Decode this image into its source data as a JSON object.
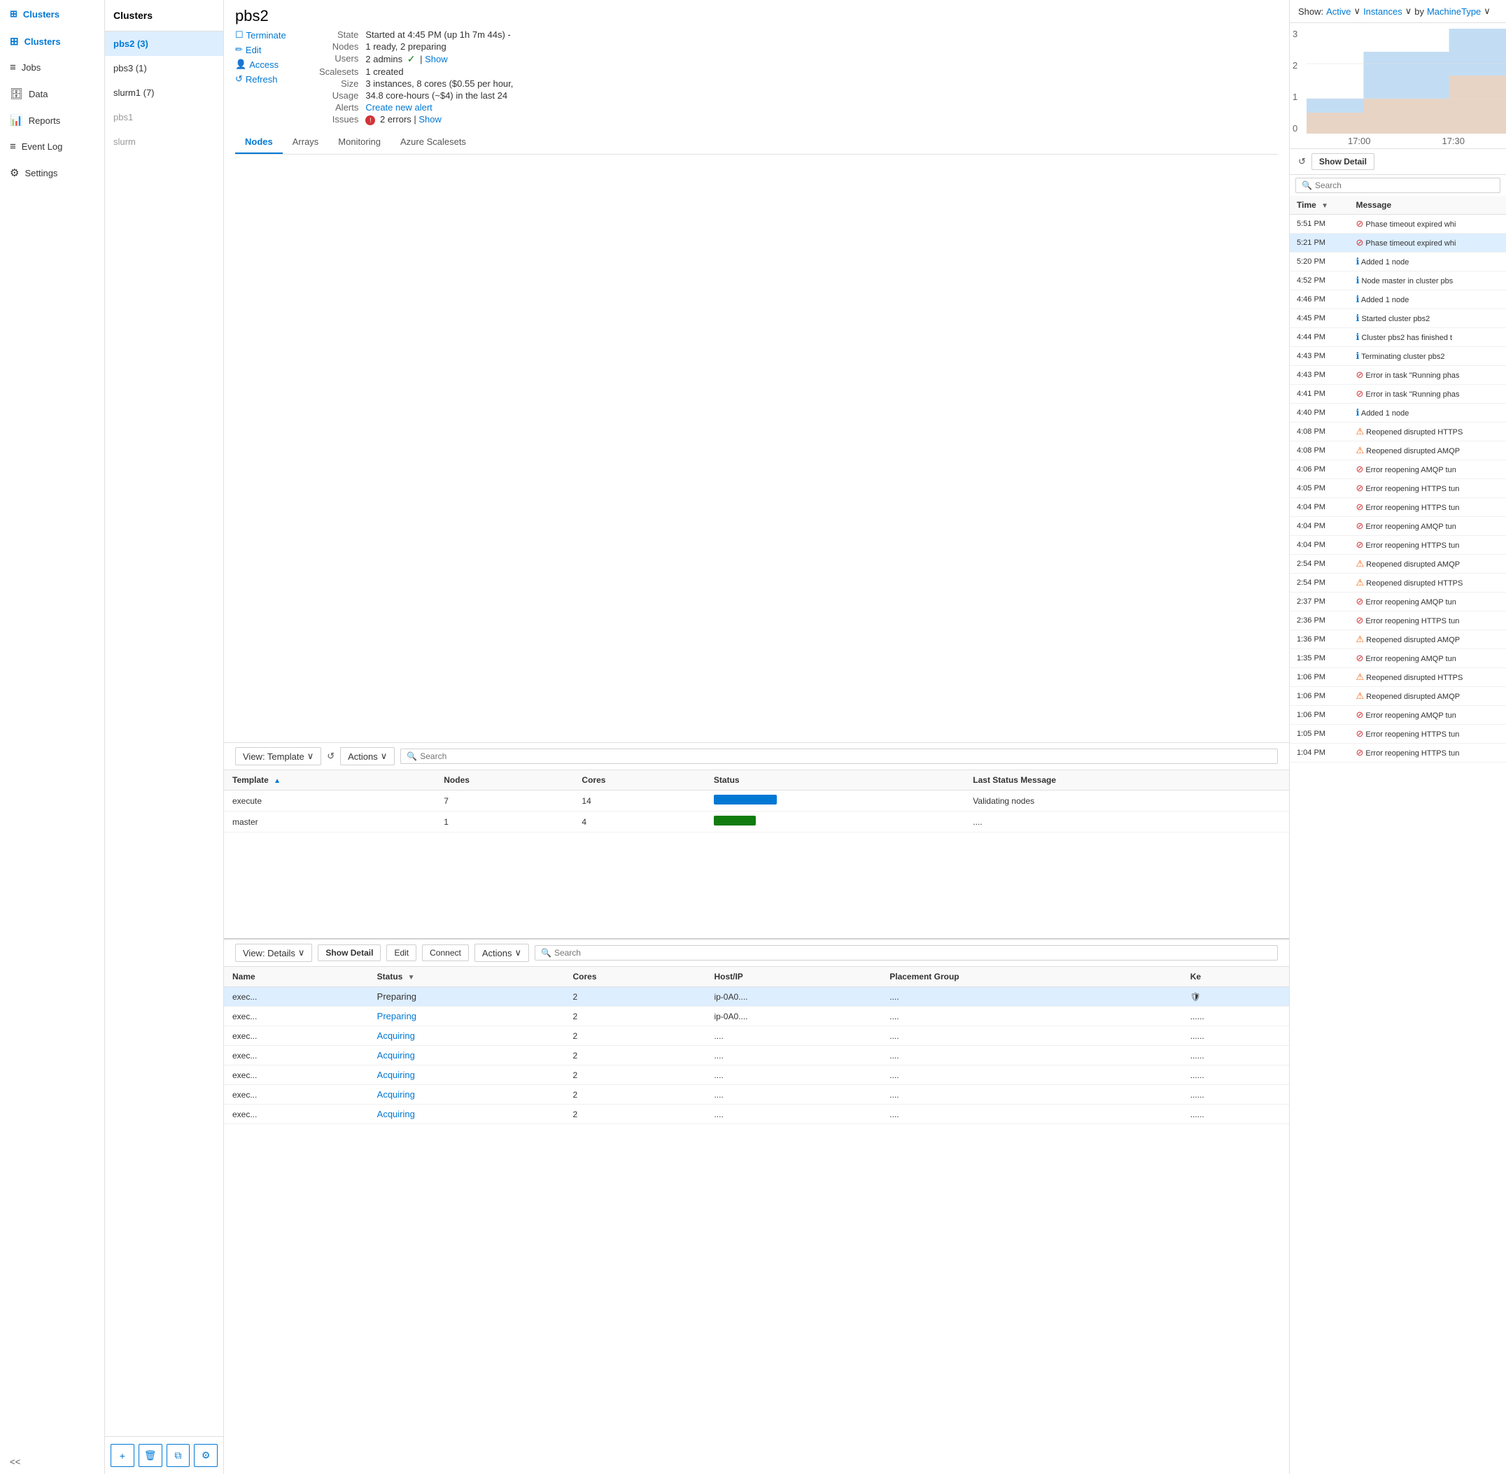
{
  "sidebar": {
    "logo": "Clusters",
    "items": [
      {
        "id": "clusters",
        "label": "Clusters",
        "icon": "⊞",
        "active": true
      },
      {
        "id": "jobs",
        "label": "Jobs",
        "icon": "≡"
      },
      {
        "id": "data",
        "label": "Data",
        "icon": "🗄"
      },
      {
        "id": "reports",
        "label": "Reports",
        "icon": "📊"
      },
      {
        "id": "eventlog",
        "label": "Event Log",
        "icon": "≡"
      },
      {
        "id": "settings",
        "label": "Settings",
        "icon": "⚙"
      }
    ],
    "collapse_label": "<<"
  },
  "cluster_list": {
    "header": "Clusters",
    "items": [
      {
        "id": "pbs2",
        "label": "pbs2 (3)",
        "selected": true
      },
      {
        "id": "pbs3",
        "label": "pbs3 (1)"
      },
      {
        "id": "slurm1",
        "label": "slurm1 (7)"
      },
      {
        "id": "pbs1",
        "label": "pbs1",
        "inactive": true
      },
      {
        "id": "slurm",
        "label": "slurm",
        "inactive": true
      }
    ],
    "buttons": [
      {
        "id": "add",
        "icon": "+"
      },
      {
        "id": "delete",
        "icon": "🗑"
      },
      {
        "id": "copy",
        "icon": "⧉"
      },
      {
        "id": "gear",
        "icon": "⚙"
      }
    ]
  },
  "cluster_detail": {
    "title": "pbs2",
    "actions": [
      {
        "id": "terminate",
        "icon": "☐",
        "label": "Terminate"
      },
      {
        "id": "edit",
        "icon": "✏",
        "label": "Edit"
      },
      {
        "id": "access",
        "icon": "👤",
        "label": "Access"
      },
      {
        "id": "refresh",
        "icon": "↺",
        "label": "Refresh"
      }
    ],
    "meta": [
      {
        "label": "State",
        "value": "Started at 4:45 PM (up 1h 7m 44s) -"
      },
      {
        "label": "Nodes",
        "value": "1 ready, 2 preparing"
      },
      {
        "label": "Users",
        "value": "2 admins ✓ | Show"
      },
      {
        "label": "Scalesets",
        "value": "1 created"
      },
      {
        "label": "Size",
        "value": "3 instances, 8 cores ($0.55 per hour,"
      },
      {
        "label": "Usage",
        "value": "34.8 core-hours (~$4) in the last 24"
      },
      {
        "label": "Alerts",
        "value": "Create new alert"
      },
      {
        "label": "Issues",
        "value": "2 errors | Show"
      }
    ],
    "tabs": [
      "Nodes",
      "Arrays",
      "Monitoring",
      "Azure Scalesets"
    ],
    "active_tab": "Nodes"
  },
  "nodes_toolbar": {
    "view_label": "View: Template",
    "refresh_title": "Refresh",
    "actions_label": "Actions",
    "search_placeholder": "Search"
  },
  "nodes_table": {
    "columns": [
      {
        "id": "template",
        "label": "Template",
        "sortable": true,
        "sort": "asc"
      },
      {
        "id": "nodes",
        "label": "Nodes"
      },
      {
        "id": "cores",
        "label": "Cores"
      },
      {
        "id": "status",
        "label": "Status"
      },
      {
        "id": "last_status",
        "label": "Last Status Message"
      }
    ],
    "rows": [
      {
        "template": "execute",
        "nodes": "7",
        "cores": "14",
        "status_type": "blue",
        "status_width": 90,
        "last_status": "Validating nodes"
      },
      {
        "template": "master",
        "nodes": "1",
        "cores": "4",
        "status_type": "green",
        "status_width": 60,
        "last_status": "...."
      }
    ]
  },
  "instances_toolbar": {
    "view_label": "View: Details",
    "show_detail_label": "Show Detail",
    "edit_label": "Edit",
    "connect_label": "Connect",
    "actions_label": "Actions",
    "search_placeholder": "Search"
  },
  "instances_table": {
    "columns": [
      {
        "id": "name",
        "label": "Name"
      },
      {
        "id": "status",
        "label": "Status",
        "sortable": true
      },
      {
        "id": "cores",
        "label": "Cores"
      },
      {
        "id": "hostip",
        "label": "Host/IP"
      },
      {
        "id": "placement",
        "label": "Placement Group"
      },
      {
        "id": "ke",
        "label": "Ke"
      }
    ],
    "rows": [
      {
        "name": "exec...",
        "status": "Preparing",
        "status_type": "text",
        "cores": "2",
        "hostip": "ip-0A0....",
        "placement": "....",
        "ke": "🛡",
        "selected": true
      },
      {
        "name": "exec...",
        "status": "Preparing",
        "status_type": "link",
        "cores": "2",
        "hostip": "ip-0A0....",
        "placement": "....",
        "ke": "......"
      },
      {
        "name": "exec...",
        "status": "Acquiring",
        "status_type": "link",
        "cores": "2",
        "hostip": "....",
        "placement": "....",
        "ke": "......"
      },
      {
        "name": "exec...",
        "status": "Acquiring",
        "status_type": "link",
        "cores": "2",
        "hostip": "....",
        "placement": "....",
        "ke": "......"
      },
      {
        "name": "exec...",
        "status": "Acquiring",
        "status_type": "link",
        "cores": "2",
        "hostip": "....",
        "placement": "....",
        "ke": "......"
      },
      {
        "name": "exec...",
        "status": "Acquiring",
        "status_type": "link",
        "cores": "2",
        "hostip": "....",
        "placement": "....",
        "ke": "......"
      },
      {
        "name": "exec...",
        "status": "Acquiring",
        "status_type": "link",
        "cores": "2",
        "hostip": "....",
        "placement": "....",
        "ke": "......"
      }
    ]
  },
  "right_panel": {
    "show_label": "Show:",
    "active_label": "Active",
    "instances_label": "Instances",
    "by_label": "by",
    "machine_type_label": "MachineType",
    "chart": {
      "y_labels": [
        "3",
        "2",
        "1",
        "0"
      ],
      "x_labels": [
        "17:00",
        "17:30"
      ],
      "series": [
        {
          "color": "#b3d4f0",
          "opacity": 0.6
        },
        {
          "color": "#f8d0b0",
          "opacity": 0.6
        }
      ]
    },
    "refresh_title": "Refresh",
    "show_detail_label": "Show Detail",
    "search_placeholder": "Search",
    "events": {
      "columns": [
        {
          "id": "time",
          "label": "Time",
          "sortable": true
        },
        {
          "id": "message",
          "label": "Message"
        }
      ],
      "rows": [
        {
          "time": "5:51 PM",
          "icon": "error",
          "message": "Phase timeout expired whi"
        },
        {
          "time": "5:21 PM",
          "icon": "error",
          "message": "Phase timeout expired whi",
          "highlighted": true
        },
        {
          "time": "5:20 PM",
          "icon": "info",
          "message": "Added 1 node"
        },
        {
          "time": "4:52 PM",
          "icon": "info",
          "message": "Node master in cluster pbs"
        },
        {
          "time": "4:46 PM",
          "icon": "info",
          "message": "Added 1 node"
        },
        {
          "time": "4:45 PM",
          "icon": "info",
          "message": "Started cluster pbs2"
        },
        {
          "time": "4:44 PM",
          "icon": "info",
          "message": "Cluster pbs2 has finished t"
        },
        {
          "time": "4:43 PM",
          "icon": "info",
          "message": "Terminating cluster pbs2"
        },
        {
          "time": "4:43 PM",
          "icon": "error",
          "message": "Error in task \"Running phas"
        },
        {
          "time": "4:41 PM",
          "icon": "error",
          "message": "Error in task \"Running phas"
        },
        {
          "time": "4:40 PM",
          "icon": "info",
          "message": "Added 1 node"
        },
        {
          "time": "4:08 PM",
          "icon": "warn",
          "message": "Reopened disrupted HTTPS"
        },
        {
          "time": "4:08 PM",
          "icon": "warn",
          "message": "Reopened disrupted AMQP"
        },
        {
          "time": "4:06 PM",
          "icon": "error",
          "message": "Error reopening AMQP tun"
        },
        {
          "time": "4:05 PM",
          "icon": "error",
          "message": "Error reopening HTTPS tun"
        },
        {
          "time": "4:04 PM",
          "icon": "error",
          "message": "Error reopening HTTPS tun"
        },
        {
          "time": "4:04 PM",
          "icon": "error",
          "message": "Error reopening AMQP tun"
        },
        {
          "time": "4:04 PM",
          "icon": "error",
          "message": "Error reopening HTTPS tun"
        },
        {
          "time": "2:54 PM",
          "icon": "warn",
          "message": "Reopened disrupted AMQP"
        },
        {
          "time": "2:54 PM",
          "icon": "warn",
          "message": "Reopened disrupted HTTPS"
        },
        {
          "time": "2:37 PM",
          "icon": "error",
          "message": "Error reopening AMQP tun"
        },
        {
          "time": "2:36 PM",
          "icon": "error",
          "message": "Error reopening HTTPS tun"
        },
        {
          "time": "1:36 PM",
          "icon": "warn",
          "message": "Reopened disrupted AMQP"
        },
        {
          "time": "1:35 PM",
          "icon": "error",
          "message": "Error reopening AMQP tun"
        },
        {
          "time": "1:06 PM",
          "icon": "warn",
          "message": "Reopened disrupted HTTPS"
        },
        {
          "time": "1:06 PM",
          "icon": "warn",
          "message": "Reopened disrupted AMQP"
        },
        {
          "time": "1:06 PM",
          "icon": "error",
          "message": "Error reopening AMQP tun"
        },
        {
          "time": "1:05 PM",
          "icon": "error",
          "message": "Error reopening HTTPS tun"
        },
        {
          "time": "1:04 PM",
          "icon": "error",
          "message": "Error reopening HTTPS tun"
        }
      ]
    }
  }
}
